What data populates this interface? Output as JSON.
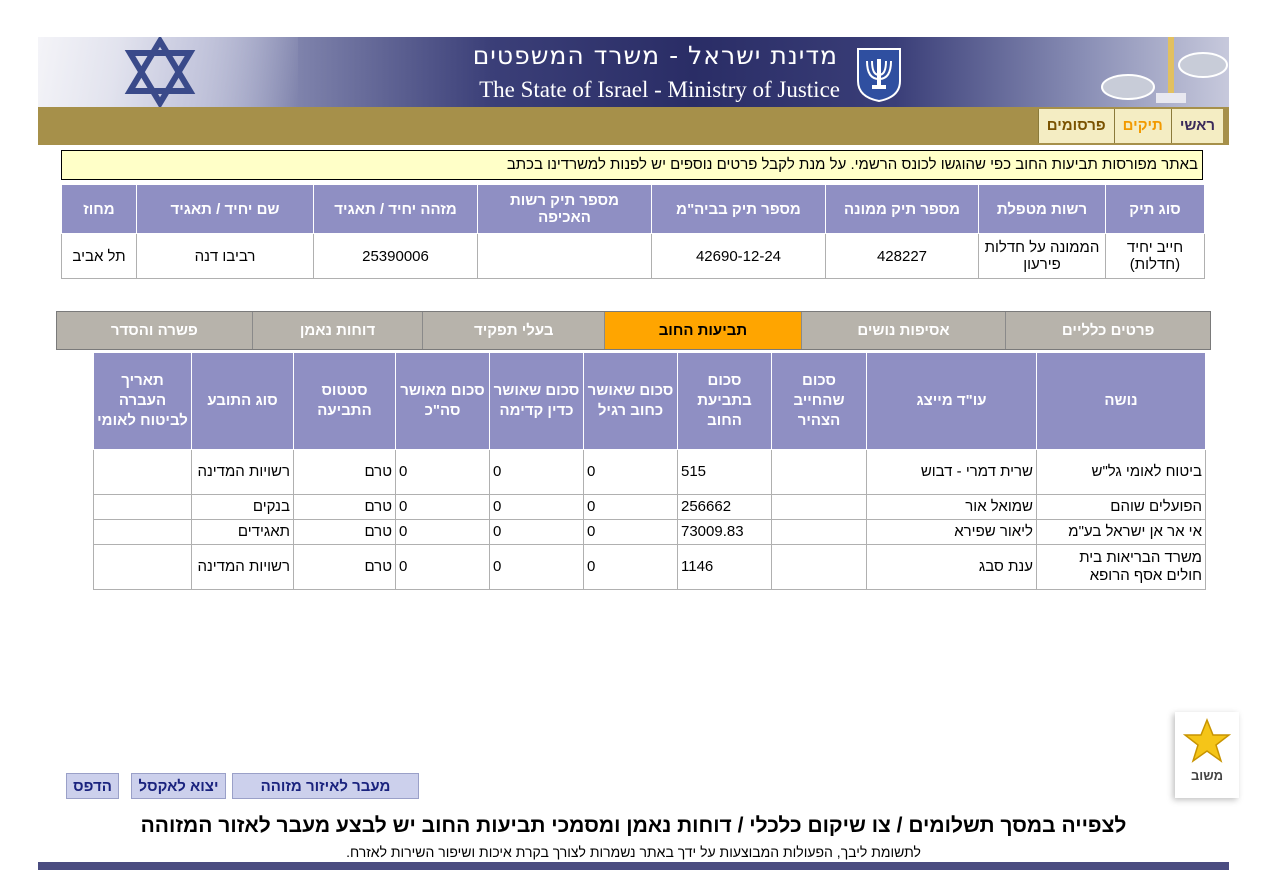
{
  "header": {
    "title_he": "מדינת ישראל - משרד המשפטים",
    "title_en": "The State of Israel - Ministry of Justice"
  },
  "nav": {
    "items": [
      "ראשי",
      "תיקים",
      "פרסומים"
    ],
    "active": "תיקים"
  },
  "notice": "באתר מפורסות תביעות החוב כפי שהוגשו לכונס הרשמי. על מנת לקבל פרטים נוספים יש לפנות למשרדינו בכתב",
  "case_table": {
    "headers": [
      "סוג תיק",
      "רשות מטפלת",
      "מספר תיק ממונה",
      "מספר תיק בביה\"מ",
      "מספר תיק רשות האכיפה",
      "מזהה יחיד / תאגיד",
      "שם יחיד / תאגיד",
      "מחוז"
    ],
    "row": [
      "חייב יחיד (חדלות)",
      "הממונה על חדלות פירעון",
      "428227",
      "42690-12-24",
      "",
      "25390006",
      "רביבו דנה",
      "תל אביב"
    ]
  },
  "tabs": {
    "items": [
      "פרטים כלליים",
      "אסיפות נושים",
      "תביעות החוב",
      "בעלי תפקיד",
      "דוחות נאמן",
      "פשרה והסדר"
    ],
    "active": "תביעות החוב"
  },
  "debt_table": {
    "headers": [
      "נושה",
      "עו\"ד מייצג",
      "סכום שהחייב הצהיר",
      "סכום בתביעת החוב",
      "סכום שאושר כחוב רגיל",
      "סכום שאושר כדין קדימה",
      "סכום מאושר סה\"כ",
      "סטטוס התביעה",
      "סוג התובע",
      "תאריך העברה לביטוח לאומי"
    ],
    "rows": [
      [
        "ביטוח לאומי גל\"ש",
        "שרית דמרי - דבוש",
        "",
        "515",
        "0",
        "0",
        "0",
        "טרם",
        "רשויות המדינה",
        ""
      ],
      [
        "הפועלים שוהם",
        "שמואל אור",
        "",
        "256662",
        "0",
        "0",
        "0",
        "טרם",
        "בנקים",
        ""
      ],
      [
        "אי אר אן ישראל בע\"מ",
        "ליאור שפירא",
        "",
        "73009.83",
        "0",
        "0",
        "0",
        "טרם",
        "תאגידים",
        ""
      ],
      [
        "משרד הבריאות בית חולים אסף הרופא",
        "ענת סבג",
        "",
        "1146",
        "0",
        "0",
        "0",
        "טרם",
        "רשויות המדינה",
        ""
      ]
    ]
  },
  "saved": {
    "label": "משוב",
    "icon": "star-icon",
    "color": "#f5c518"
  },
  "buttons": {
    "goto_identified": "מעבר לאיזור מזוהה",
    "export_excel": "יצוא לאקסל",
    "print": "הדפס"
  },
  "footer": {
    "title": "לצפייה במסך תשלומים / צו שיקום כלכלי / דוחות נאמן ומסמכי תביעות החוב יש לבצע מעבר לאזור המזוהה",
    "note": "לתשומת ליבך, הפעולות המבוצעות על ידך באתר נשמרות לצורך בקרת איכות ושיפור השירות לאזרח."
  },
  "colors": {
    "header_cell": "#8f8fc3",
    "nav_bar": "#a6904a",
    "active_tab": "#ffa500",
    "notice_bg": "#ffffc8"
  }
}
